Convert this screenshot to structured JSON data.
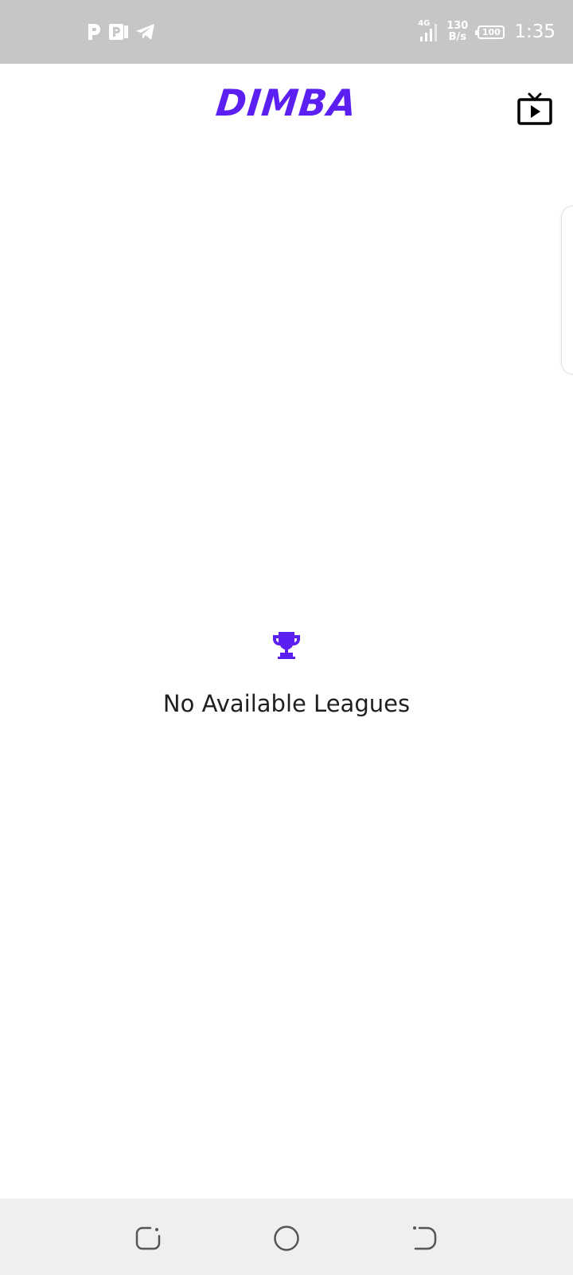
{
  "status_bar": {
    "left_icons": [
      "p-app-icon",
      "parking-app-icon",
      "telegram-icon"
    ],
    "network_type": "4G",
    "speed_value": "130",
    "speed_unit": "B/s",
    "battery_level": "100",
    "time": "1:35"
  },
  "app_bar": {
    "logo_text": "DIMBA",
    "live_tv_icon": "live-tv-icon"
  },
  "empty_state": {
    "icon": "trophy-icon",
    "message": "No Available Leagues"
  },
  "nav_bar": {
    "recent_icon": "recent-apps-icon",
    "home_icon": "home-icon",
    "back_icon": "back-icon"
  },
  "colors": {
    "accent": "#5b1ff2",
    "status_bar_bg": "#c6c6c6",
    "nav_bar_bg": "#efefef",
    "text_primary": "#1f1f1f"
  }
}
